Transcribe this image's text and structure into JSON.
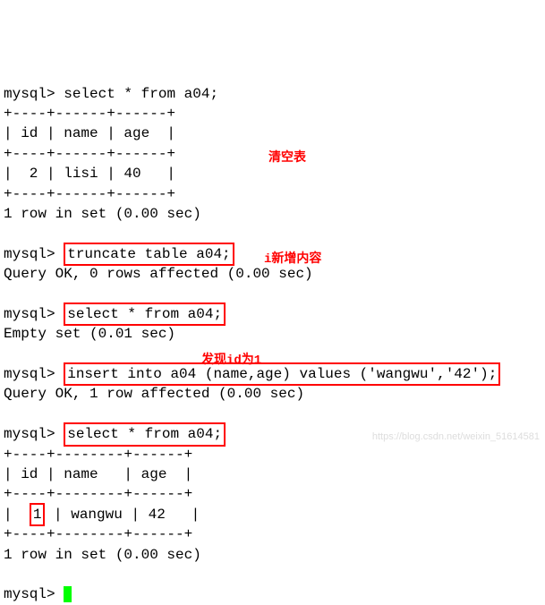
{
  "prompt": "mysql>",
  "queries": {
    "q1": "select * from a04;",
    "q2": "truncate table a04;",
    "q3": "select * from a04;",
    "q4": "insert into a04 (name,age) values ('wangwu','42');",
    "q5": "select * from a04;"
  },
  "responses": {
    "rows1": "1 row in set (0.00 sec)",
    "ok2": "Query OK, 0 rows affected (0.00 sec)",
    "empty3": "Empty set (0.01 sec)",
    "ok4": "Query OK, 1 row affected (0.00 sec)",
    "rows5": "1 row in set (0.00 sec)"
  },
  "table1": {
    "border_top": "+----+------+------+",
    "header": "| id | name | age  |",
    "border_mid": "+----+------+------+",
    "row": "|  2 | lisi | 40   |",
    "border_bot": "+----+------+------+"
  },
  "table2": {
    "border_top": "+----+--------+------+",
    "header": "| id | name   | age  |",
    "border_mid": "+----+--------+------+",
    "row_pre": "|  ",
    "row_id": "1",
    "row_post": " | wangwu | 42   |",
    "border_bot": "+----+--------+------+"
  },
  "annotations": {
    "a1": "清空表",
    "a2": "i新增内容",
    "a3": "发现id为1"
  },
  "watermark": "https://blog.csdn.net/weixin_51614581",
  "chart_data": {
    "type": "table",
    "before_truncate": {
      "columns": [
        "id",
        "name",
        "age"
      ],
      "rows": [
        [
          2,
          "lisi",
          40
        ]
      ]
    },
    "after_insert": {
      "columns": [
        "id",
        "name",
        "age"
      ],
      "rows": [
        [
          1,
          "wangwu",
          42
        ]
      ]
    }
  }
}
